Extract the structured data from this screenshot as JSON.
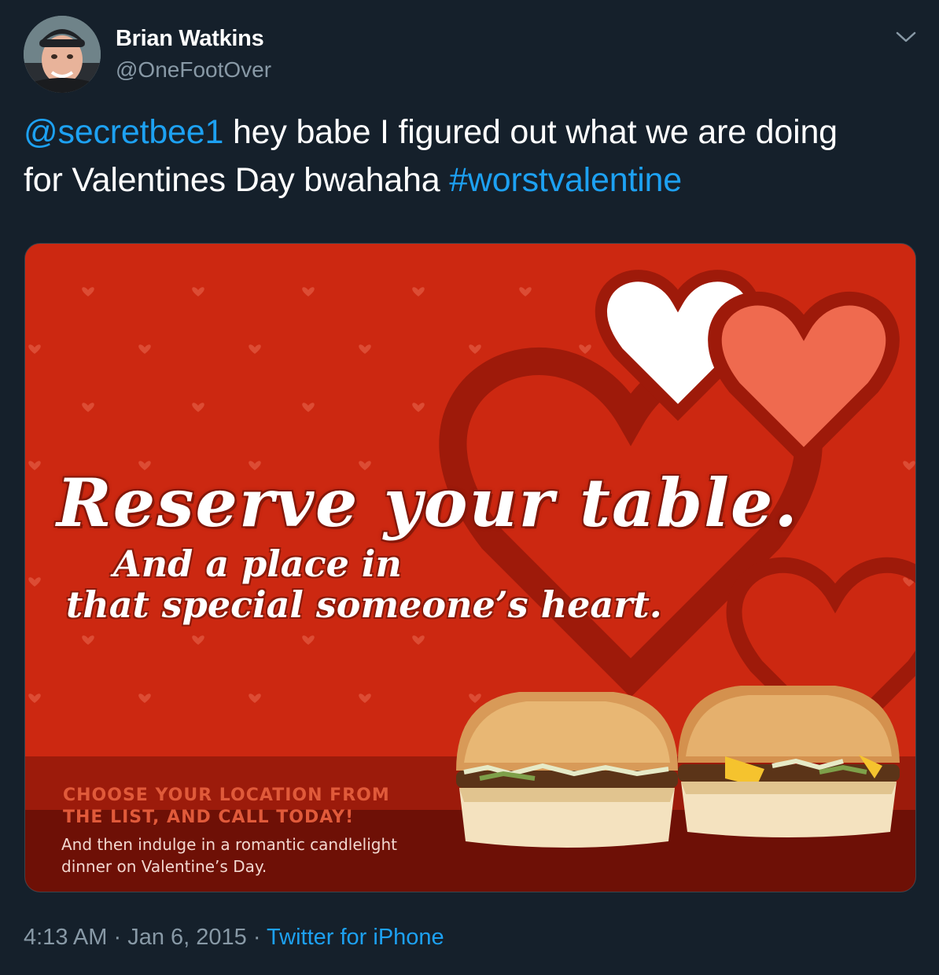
{
  "author": {
    "name": "Brian Watkins",
    "handle": "@OneFootOver"
  },
  "tweet": {
    "mention": "@secretbee1",
    "text_part1": " hey babe I figured out what we are doing",
    "text_part2": "for Valentines Day bwahaha ",
    "hashtag": "#worstvalentine"
  },
  "media": {
    "headline": "Reserve your table.",
    "subline1": "And a place in",
    "subline2": "that special someone’s heart.",
    "cta_line1": "CHOOSE YOUR LOCATION FROM",
    "cta_line2": "THE LIST, AND CALL TODAY!",
    "body_line1": "And then indulge in a romantic candlelight",
    "body_line2": "dinner on Valentine’s Day."
  },
  "meta": {
    "time": "4:13 AM",
    "separator1": " · ",
    "date": "Jan 6, 2015",
    "separator2": " · ",
    "source": "Twitter for iPhone"
  },
  "colors": {
    "background": "#15202b",
    "link": "#1da1f2",
    "secondary_text": "#8899a6",
    "ad_red": "#c8230f",
    "ad_dark_red": "#7a1207"
  },
  "icons": {
    "menu": "chevron-down-icon"
  }
}
